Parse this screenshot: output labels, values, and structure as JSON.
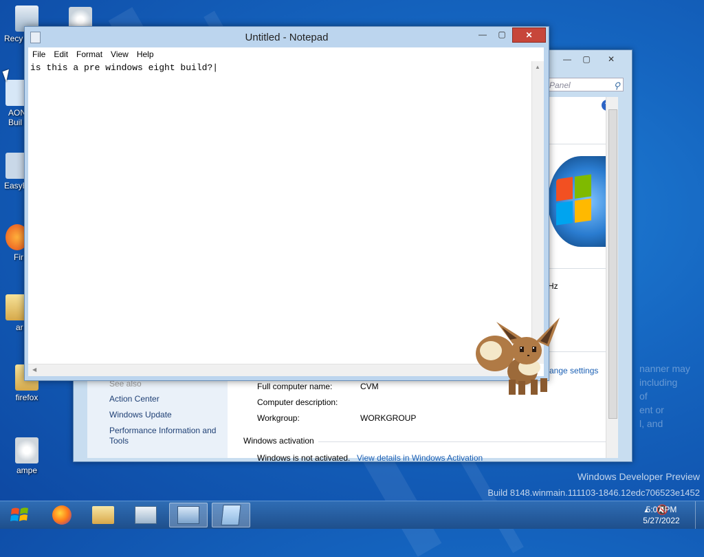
{
  "desktop": {
    "icons": [
      {
        "label": "Recy"
      },
      {
        "label": ""
      },
      {
        "label": "AON\nBuil"
      },
      {
        "label": "EasyB"
      },
      {
        "label": "Fir"
      },
      {
        "label": "ar"
      },
      {
        "label": "firefox"
      },
      {
        "label": "ampe"
      }
    ],
    "watermark_line1": "Windows Developer Preview",
    "watermark_line2": "Build 8148.winmain.111103-1846.12edc706523e1452",
    "bg_text": [
      "nanner may",
      "including",
      "of",
      "ent or",
      "l, and"
    ]
  },
  "notepad": {
    "title": "Untitled - Notepad",
    "menu": [
      "File",
      "Edit",
      "Format",
      "View",
      "Help"
    ],
    "content": "is this a pre windows eight build?",
    "buttons": {
      "minimize": "—",
      "maximize": "▢",
      "close": "✕"
    }
  },
  "control_panel": {
    "search_placeholder": "Panel",
    "change_settings": "ange settings",
    "see_also": "See also",
    "side_links": [
      "Action Center",
      "Windows Update",
      "Performance Information and Tools"
    ],
    "ghz": "Hz",
    "rows": [
      {
        "label": "Full computer name:",
        "value": "CVM"
      },
      {
        "label": "Computer description:",
        "value": ""
      },
      {
        "label": "Workgroup:",
        "value": "WORKGROUP"
      }
    ],
    "activation_header": "Windows activation",
    "activation_text": "Windows is not activated.",
    "activation_link": "View details in Windows Activation"
  },
  "taskbar": {
    "clock_time": "5:07 PM",
    "clock_date": "5/27/2022",
    "tray_arrow": "▲"
  }
}
